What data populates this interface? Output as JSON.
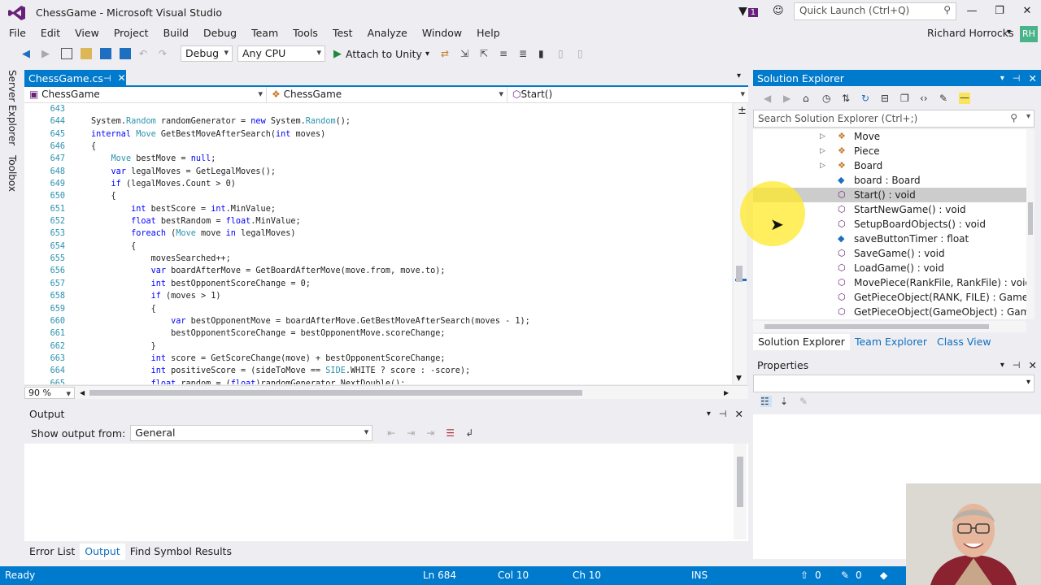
{
  "window": {
    "title": "ChessGame - Microsoft Visual Studio",
    "notification_count": "1",
    "quick_launch_placeholder": "Quick Launch (Ctrl+Q)",
    "minimize": "—",
    "restore": "❐",
    "close": "✕"
  },
  "menu": [
    "File",
    "Edit",
    "View",
    "Project",
    "Build",
    "Debug",
    "Team",
    "Tools",
    "Test",
    "Analyze",
    "Window",
    "Help"
  ],
  "user": {
    "name": "Richard Horrocks",
    "initials": "RH"
  },
  "toolbar": {
    "config": "Debug",
    "platform": "Any CPU",
    "attach_label": "Attach to Unity"
  },
  "left_strip": [
    "Server Explorer",
    "Toolbox"
  ],
  "editor": {
    "tab_label": "ChessGame.cs",
    "tab_pin": "⊣",
    "tab_close": "✕",
    "nav_project": "ChessGame",
    "nav_class": "ChessGame",
    "nav_member": "Start()",
    "zoom": "90 %",
    "lines": [
      {
        "n": "643",
        "t": ""
      },
      {
        "n": "644",
        "t": "System.Random randomGenerator = new System.Random();"
      },
      {
        "n": "645",
        "t": "internal Move GetBestMoveAfterSearch(int moves)"
      },
      {
        "n": "646",
        "t": "{"
      },
      {
        "n": "647",
        "t": "    Move bestMove = null;"
      },
      {
        "n": "648",
        "t": "    var legalMoves = GetLegalMoves();"
      },
      {
        "n": "649",
        "t": "    if (legalMoves.Count > 0)"
      },
      {
        "n": "650",
        "t": "    {"
      },
      {
        "n": "651",
        "t": "        int bestScore = int.MinValue;"
      },
      {
        "n": "652",
        "t": "        float bestRandom = float.MinValue;"
      },
      {
        "n": "653",
        "t": "        foreach (Move move in legalMoves)"
      },
      {
        "n": "654",
        "t": "        {"
      },
      {
        "n": "655",
        "t": "            movesSearched++;"
      },
      {
        "n": "656",
        "t": "            var boardAfterMove = GetBoardAfterMove(move.from, move.to);"
      },
      {
        "n": "657",
        "t": "            int bestOpponentScoreChange = 0;"
      },
      {
        "n": "658",
        "t": "            if (moves > 1)"
      },
      {
        "n": "659",
        "t": "            {"
      },
      {
        "n": "660",
        "t": "                var bestOpponentMove = boardAfterMove.GetBestMoveAfterSearch(moves - 1);"
      },
      {
        "n": "661",
        "t": "                bestOpponentScoreChange = bestOpponentMove.scoreChange;"
      },
      {
        "n": "662",
        "t": "            }"
      },
      {
        "n": "663",
        "t": "            int score = GetScoreChange(move) + bestOpponentScoreChange;"
      },
      {
        "n": "664",
        "t": "            int positiveScore = (sideToMove == SIDE.WHITE ? score : -score);"
      },
      {
        "n": "665",
        "t": "            float random = (float)randomGenerator.NextDouble();"
      }
    ]
  },
  "output": {
    "title": "Output",
    "show_from_label": "Show output from:",
    "source": "General"
  },
  "bottom_tabs": [
    "Error List",
    "Output",
    "Find Symbol Results"
  ],
  "solution_explorer": {
    "title": "Solution Explorer",
    "search_placeholder": "Search Solution Explorer (Ctrl+;)",
    "items": [
      {
        "label": "Move",
        "kind": "class",
        "expandable": true
      },
      {
        "label": "Piece",
        "kind": "class",
        "expandable": true
      },
      {
        "label": "Board",
        "kind": "class",
        "expandable": true
      },
      {
        "label": "board : Board",
        "kind": "field",
        "expandable": false
      },
      {
        "label": "Start() : void",
        "kind": "method",
        "expandable": false,
        "selected": true
      },
      {
        "label": "StartNewGame() : void",
        "kind": "method",
        "expandable": false
      },
      {
        "label": "SetupBoardObjects() : void",
        "kind": "method",
        "expandable": false
      },
      {
        "label": "saveButtonTimer : float",
        "kind": "field",
        "expandable": false
      },
      {
        "label": "SaveGame() : void",
        "kind": "method",
        "expandable": false
      },
      {
        "label": "LoadGame() : void",
        "kind": "method",
        "expandable": false
      },
      {
        "label": "MovePiece(RankFile, RankFile) : void",
        "kind": "method",
        "expandable": false
      },
      {
        "label": "GetPieceObject(RANK, FILE) : GameObj",
        "kind": "method",
        "expandable": false
      },
      {
        "label": "GetPieceObject(GameObject) : GameOb",
        "kind": "method",
        "expandable": false
      }
    ],
    "tabs": [
      "Solution Explorer",
      "Team Explorer",
      "Class View"
    ]
  },
  "properties": {
    "title": "Properties"
  },
  "status": {
    "ready": "Ready",
    "line": "Ln 684",
    "col": "Col 10",
    "ch": "Ch 10",
    "mode": "INS",
    "up_count": "0",
    "edit_count": "0"
  },
  "colors": {
    "accent": "#007acc",
    "keyword": "#0000ff",
    "type": "#2b91af",
    "highlight": "#ffe828"
  }
}
